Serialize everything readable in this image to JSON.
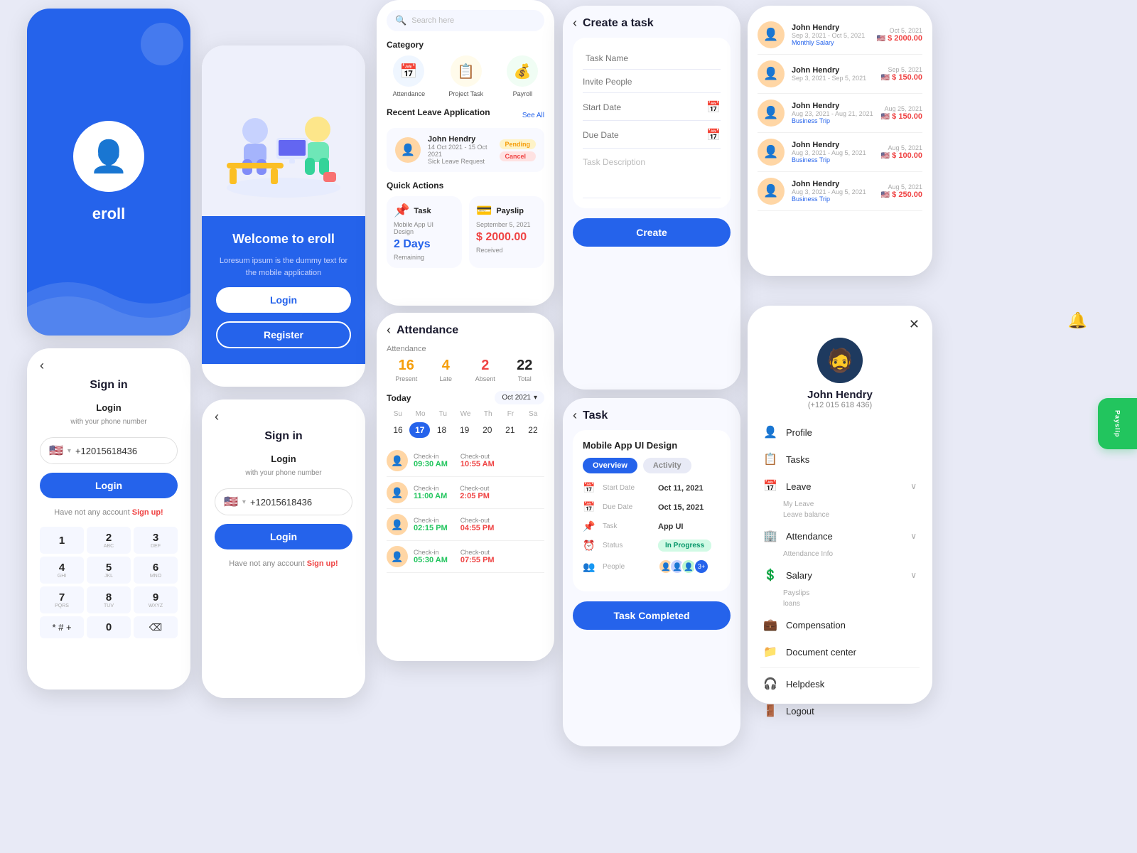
{
  "app": {
    "name": "eroll",
    "tagline": "Loresum ipsum is the dummy text for the mobile application"
  },
  "colors": {
    "primary": "#2563eb",
    "danger": "#ef4444",
    "warning": "#f59e0b",
    "success": "#22c55e",
    "bg_light": "#e8eaf6"
  },
  "screen_eroll": {
    "title": "eroll"
  },
  "screen_signin": {
    "back_label": "‹",
    "title": "Sign in",
    "login_label": "Login",
    "login_sublabel": "with your phone number",
    "phone": "+12015618436",
    "flag": "🇺🇸",
    "button_label": "Login",
    "no_account": "Have not any account",
    "signup_label": "Sign up!",
    "numpad": [
      {
        "top": "1",
        "bottom": ""
      },
      {
        "top": "2",
        "bottom": "ABC"
      },
      {
        "top": "3",
        "bottom": "DEF"
      },
      {
        "top": "4",
        "bottom": "GHI"
      },
      {
        "top": "5",
        "bottom": "JKL"
      },
      {
        "top": "6",
        "bottom": "MNO"
      },
      {
        "top": "7",
        "bottom": "PQRS"
      },
      {
        "top": "8",
        "bottom": "TUV"
      },
      {
        "top": "9",
        "bottom": "WXYZ"
      },
      {
        "top": "*#",
        "bottom": ""
      },
      {
        "top": "0",
        "bottom": ""
      },
      {
        "top": "⌫",
        "bottom": ""
      }
    ]
  },
  "screen_welcome": {
    "title": "Welcome to eroll",
    "description": "Loresum ipsum is the dummy text for the mobile application",
    "login_label": "Login",
    "register_label": "Register"
  },
  "screen_signin2": {
    "back_label": "‹",
    "title": "Sign in",
    "login_label": "Login",
    "login_sublabel": "with your phone number",
    "phone": "+12015618436",
    "flag": "🇺🇸",
    "button_label": "Login",
    "no_account": "Have not any account",
    "signup_label": "Sign up!"
  },
  "screen_dashboard": {
    "search_placeholder": "Search here",
    "category_label": "Category",
    "categories": [
      {
        "icon": "📅",
        "label": "Attendance",
        "color": "#2563eb"
      },
      {
        "icon": "📋",
        "label": "Project Task",
        "color": "#f59e0b"
      },
      {
        "icon": "💰",
        "label": "Payroll",
        "color": "#22c55e"
      }
    ],
    "recent_leave_label": "Recent Leave Application",
    "see_all": "See All",
    "leave_record": {
      "name": "John Hendry",
      "dates": "14 Oct 2021 - 15 Oct 2021",
      "type": "Sick Leave Request",
      "badge1": "Pending",
      "badge2": "Cancel"
    },
    "quick_actions_label": "Quick Actions",
    "task_card": {
      "icon": "📌",
      "label": "Task",
      "sublabel": "Mobile App UI Design",
      "value": "2 Days",
      "unit": "Remaining"
    },
    "payslip_card": {
      "icon": "💳",
      "label": "Payslip",
      "sublabel": "September 5, 2021",
      "amount": "$ 2000.00",
      "unit": "Received"
    }
  },
  "screen_attendance": {
    "title": "Attendance",
    "stats": [
      {
        "label": "Attendance",
        "value": "",
        "sub": ""
      },
      {
        "label": "Present",
        "value": "16",
        "color": "warning"
      },
      {
        "label": "Late",
        "value": "4",
        "color": "warning"
      },
      {
        "label": "Absent",
        "value": "2",
        "color": "danger"
      },
      {
        "label": "Total",
        "value": "22",
        "color": "dark"
      }
    ],
    "today_label": "Today",
    "month": "Oct 2021",
    "week_days": [
      "Su",
      "Mo",
      "Tu",
      "We",
      "Th",
      "Fr",
      "Sa"
    ],
    "week_dates": [
      "16",
      "17",
      "18",
      "19",
      "20",
      "21",
      "22"
    ],
    "active_date": "17",
    "records": [
      {
        "checkin": "09:30 AM",
        "checkout": "10:55 AM"
      },
      {
        "checkin": "11:00 AM",
        "checkout": "2:05 PM"
      },
      {
        "checkin": "02:15 PM",
        "checkout": "04:55 PM"
      },
      {
        "checkin": "05:30 AM",
        "checkout": "07:55 PM"
      }
    ]
  },
  "screen_create_task": {
    "back_label": "‹",
    "title": "Create a task",
    "task_name_placeholder": "Task Name",
    "invite_placeholder": "Invite People",
    "start_date_placeholder": "Start Date",
    "due_date_placeholder": "Due Date",
    "description_placeholder": "Task Description",
    "create_button": "Create"
  },
  "screen_task_detail": {
    "back_label": "‹",
    "title": "Task",
    "task_name": "Mobile App UI Design",
    "tab_overview": "Overview",
    "tab_activity": "Activity",
    "start_date_label": "Start Date",
    "start_date_value": "Oct 11, 2021",
    "due_date_label": "Due Date",
    "due_date_value": "Oct 15, 2021",
    "task_label": "Task",
    "task_value": "App UI",
    "status_label": "Status",
    "status_value": "In Progress",
    "people_label": "People",
    "completed_button": "Task Completed"
  },
  "screen_transactions": {
    "records": [
      {
        "name": "John Hendry",
        "date_range": "Sep 3, 2021 - Oct 5, 2021",
        "type": "Monthly Salary",
        "date": "Oct 5, 2021",
        "amount": "$ 2000.00"
      },
      {
        "name": "John Hendry",
        "date_range": "Sep 3, 2021 - Sep 5, 2021",
        "type": "",
        "date": "Sep 5, 2021",
        "amount": "$ 150.00"
      },
      {
        "name": "John Hendry",
        "date_range": "Aug 23, 2021 - Aug 21, 2021",
        "type": "Business Trip",
        "date": "Aug 25, 2021",
        "amount": "$ 150.00"
      },
      {
        "name": "John Hendry",
        "date_range": "Aug 3, 2021 - Aug 5, 2021",
        "type": "Business Trip",
        "date": "Aug 5, 2021",
        "amount": "$ 100.00"
      },
      {
        "name": "John Hendry",
        "date_range": "Aug 3, 2021 - Aug 5, 2021",
        "type": "Business Trip",
        "date": "Aug 5, 2021",
        "amount": "$ 250.00"
      }
    ]
  },
  "screen_profile": {
    "close_label": "✕",
    "name": "John Hendry",
    "phone": "(+12 015 618 436)",
    "menu_items": [
      {
        "icon": "👤",
        "label": "Profile"
      },
      {
        "icon": "📋",
        "label": "Tasks"
      },
      {
        "icon": "📅",
        "label": "Leave",
        "has_chevron": true,
        "sub_items": [
          "My Leave",
          "Leave balance"
        ]
      },
      {
        "icon": "🏢",
        "label": "Attendance",
        "has_chevron": true,
        "sub_items": [
          "Attendance Info"
        ]
      },
      {
        "icon": "💲",
        "label": "Salary",
        "has_chevron": true,
        "sub_items": [
          "Payslips",
          "loans"
        ]
      },
      {
        "icon": "💼",
        "label": "Compensation"
      },
      {
        "icon": "📁",
        "label": "Document center"
      },
      {
        "icon": "🎧",
        "label": "Helpdesk"
      },
      {
        "icon": "🚪",
        "label": "Logout"
      }
    ]
  }
}
